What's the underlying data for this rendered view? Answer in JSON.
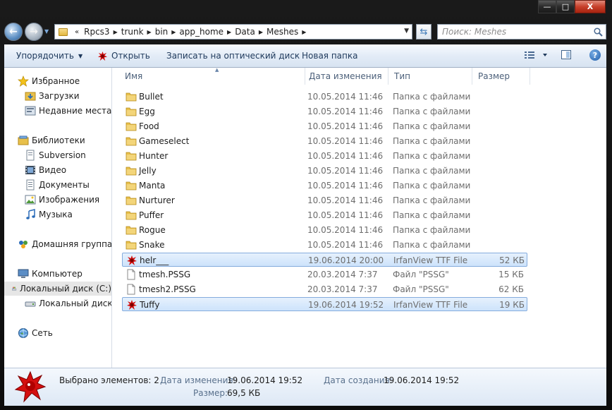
{
  "window": {
    "caption": {
      "minimize": "—",
      "maximize": "□",
      "close": "X"
    }
  },
  "address_bar": {
    "overflow": "«",
    "segments": [
      "Rpcs3",
      "trunk",
      "bin",
      "app_home",
      "Data",
      "Meshes"
    ]
  },
  "search": {
    "placeholder": "Поиск: Meshes"
  },
  "toolbar": {
    "organize": "Упорядочить",
    "open": "Открыть",
    "burn": "Записать на оптический диск",
    "new_folder": "Новая папка",
    "help": "?"
  },
  "nav": {
    "favorites": {
      "label": "Избранное",
      "items": [
        "Загрузки",
        "Недавние места"
      ]
    },
    "libraries": {
      "label": "Библиотеки",
      "items": [
        "Subversion",
        "Видео",
        "Документы",
        "Изображения",
        "Музыка"
      ]
    },
    "homegroup": "Домашняя группа",
    "computer": {
      "label": "Компьютер",
      "items": [
        "Локальный диск (C:)",
        "Локальный диск (D:)"
      ]
    },
    "network": "Сеть"
  },
  "columns": {
    "name": "Имя",
    "date": "Дата изменения",
    "type": "Тип",
    "size": "Размер"
  },
  "files": [
    {
      "name": "Bullet",
      "date": "10.05.2014 11:46",
      "type": "Папка с файлами",
      "size": "",
      "icon": "folder-icon",
      "selected": false
    },
    {
      "name": "Egg",
      "date": "10.05.2014 11:46",
      "type": "Папка с файлами",
      "size": "",
      "icon": "folder-icon",
      "selected": false
    },
    {
      "name": "Food",
      "date": "10.05.2014 11:46",
      "type": "Папка с файлами",
      "size": "",
      "icon": "folder-icon",
      "selected": false
    },
    {
      "name": "Gameselect",
      "date": "10.05.2014 11:46",
      "type": "Папка с файлами",
      "size": "",
      "icon": "folder-icon",
      "selected": false
    },
    {
      "name": "Hunter",
      "date": "10.05.2014 11:46",
      "type": "Папка с файлами",
      "size": "",
      "icon": "folder-icon",
      "selected": false
    },
    {
      "name": "Jelly",
      "date": "10.05.2014 11:46",
      "type": "Папка с файлами",
      "size": "",
      "icon": "folder-icon",
      "selected": false
    },
    {
      "name": "Manta",
      "date": "10.05.2014 11:46",
      "type": "Папка с файлами",
      "size": "",
      "icon": "folder-icon",
      "selected": false
    },
    {
      "name": "Nurturer",
      "date": "10.05.2014 11:46",
      "type": "Папка с файлами",
      "size": "",
      "icon": "folder-icon",
      "selected": false
    },
    {
      "name": "Puffer",
      "date": "10.05.2014 11:46",
      "type": "Папка с файлами",
      "size": "",
      "icon": "folder-icon",
      "selected": false
    },
    {
      "name": "Rogue",
      "date": "10.05.2014 11:46",
      "type": "Папка с файлами",
      "size": "",
      "icon": "folder-icon",
      "selected": false
    },
    {
      "name": "Snake",
      "date": "10.05.2014 11:46",
      "type": "Папка с файлами",
      "size": "",
      "icon": "folder-icon",
      "selected": false
    },
    {
      "name": "helr___",
      "date": "19.06.2014 20:00",
      "type": "IrfanView TTF File",
      "size": "52 КБ",
      "icon": "irfanview-icon",
      "selected": true
    },
    {
      "name": "tmesh.PSSG",
      "date": "20.03.2014 7:37",
      "type": "Файл \"PSSG\"",
      "size": "15 КБ",
      "icon": "file-icon",
      "selected": false
    },
    {
      "name": "tmesh2.PSSG",
      "date": "20.03.2014 7:37",
      "type": "Файл \"PSSG\"",
      "size": "62 КБ",
      "icon": "file-icon",
      "selected": false
    },
    {
      "name": "Tuffy",
      "date": "19.06.2014 19:52",
      "type": "IrfanView TTF File",
      "size": "19 КБ",
      "icon": "irfanview-icon",
      "selected": true
    }
  ],
  "details": {
    "selected_count": "Выбрано элементов: 2",
    "modified_label": "Дата изменения:",
    "modified_value": "19.06.2014 19:52",
    "size_label": "Размер:",
    "size_value": "69,5 КБ",
    "created_label": "Дата создания:",
    "created_value": "19.06.2014 19:52"
  },
  "colors": {
    "toolbar_text": "#1e395b",
    "selection_border": "#84acdd",
    "folder": "#e8c04a",
    "irfanview_red": "#d40f0f"
  }
}
